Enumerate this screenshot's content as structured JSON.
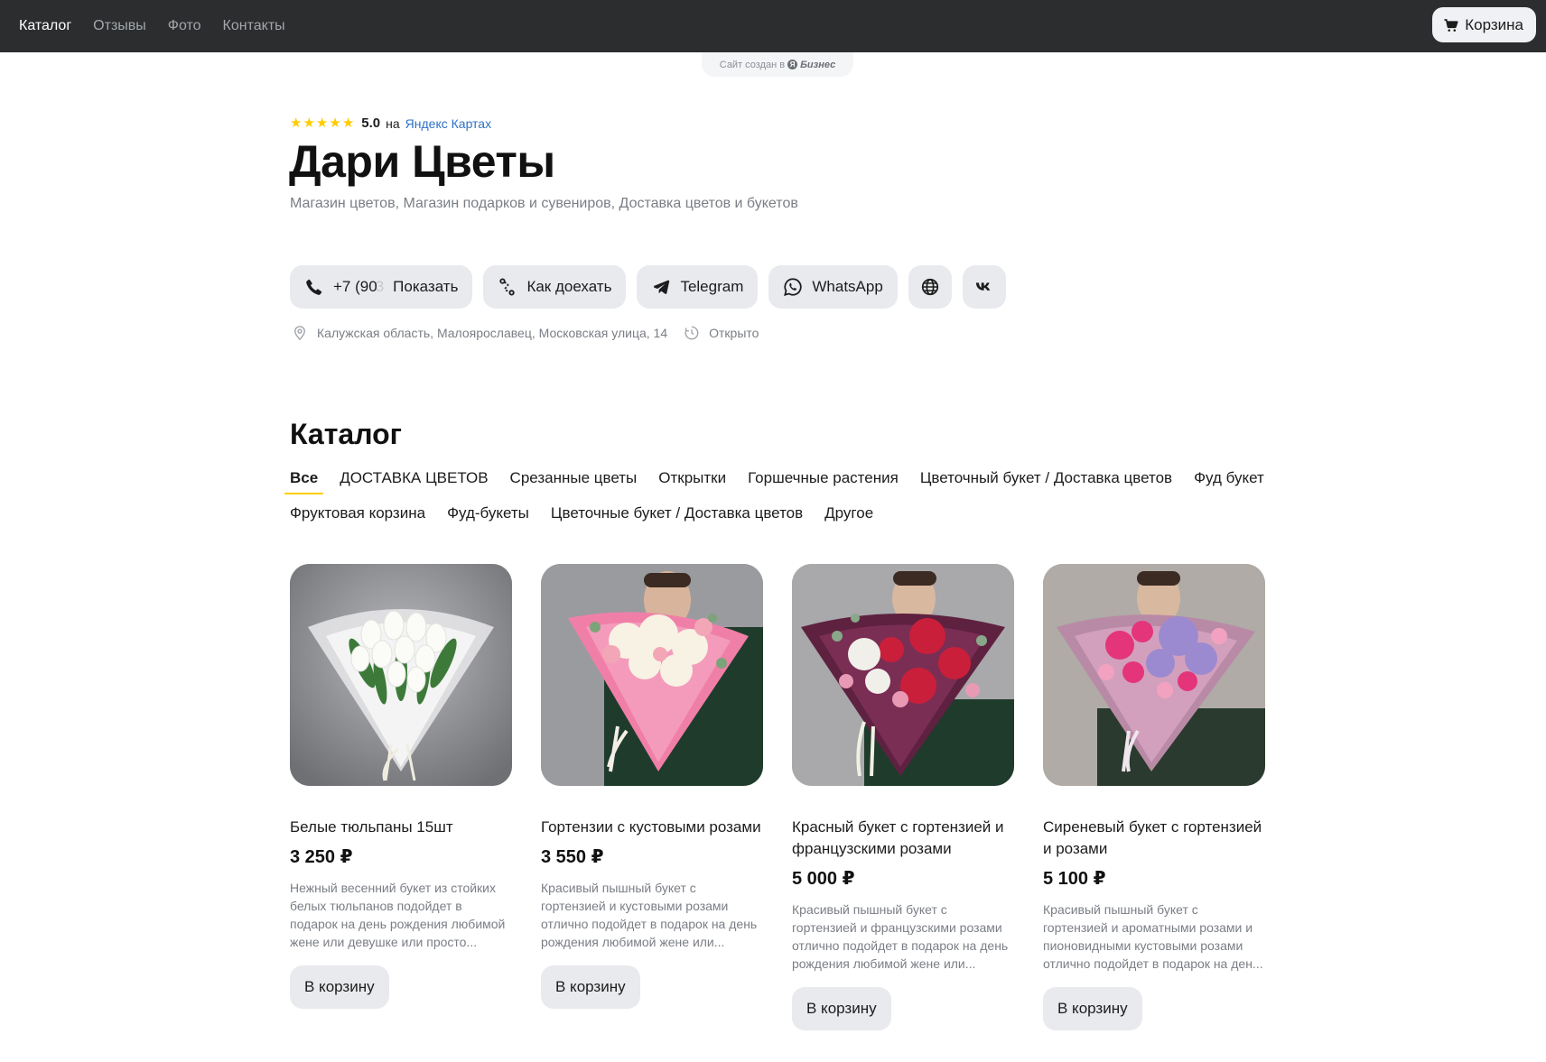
{
  "nav": {
    "items": [
      {
        "label": "Каталог",
        "active": true
      },
      {
        "label": "Отзывы",
        "active": false
      },
      {
        "label": "Фото",
        "active": false
      },
      {
        "label": "Контакты",
        "active": false
      }
    ],
    "cart_label": "Корзина"
  },
  "badge": {
    "text": "Сайт создан в",
    "brand": "Бизнес",
    "logo_letter": "Я"
  },
  "business": {
    "rating": "5.0",
    "rating_on": "на",
    "rating_source": "Яндекс Картах",
    "name": "Дари Цветы",
    "categories": "Магазин цветов, Магазин подарков и сувениров, Доставка цветов и букетов",
    "address": "Калужская область, Малоярославец, Московская улица, 14",
    "status": "Открыто"
  },
  "actions": {
    "phone_prefix": "+7 (90",
    "phone_mask": "3",
    "phone_show": "Показать",
    "route": "Как доехать",
    "telegram": "Telegram",
    "whatsapp": "WhatsApp"
  },
  "catalog": {
    "title": "Каталог",
    "tabs_row1": [
      "Все",
      "ДОСТАВКА ЦВЕТОВ",
      "Срезанные цветы",
      "Открытки",
      "Горшечные растения",
      "Цветочный букет / Доставка цветов",
      "Фуд букет"
    ],
    "tabs_row2": [
      "Фруктовая корзина",
      "Фуд-букеты",
      "Цветочные букет / Доставка цветов",
      "Другое"
    ],
    "add_label": "В корзину",
    "products": [
      {
        "name": "Белые тюльпаны 15шт",
        "price": "3 250 ₽",
        "desc": "Нежный весенний букет из стойких белых тюльпанов подойдет в подарок на день рождения любимой жене или девушке или просто..."
      },
      {
        "name": "Гортензии с кустовыми розами",
        "price": "3 550 ₽",
        "desc": "Красивый пышный букет с гортензией и кустовыми розами отлично подойдет в подарок на день рождения любимой жене или..."
      },
      {
        "name": "Красный букет с гортензией и французскими розами",
        "price": "5 000 ₽",
        "desc": "Красивый пышный букет с гортензией и французскими розами отлично подойдет в подарок на день рождения любимой жене или..."
      },
      {
        "name": "Сиреневый букет с гортензией и розами",
        "price": "5 100 ₽",
        "desc": "Красивый пышный букет с гортензией и ароматными розами и пионовидными кустовыми розами отлично подойдет в подарок на ден..."
      }
    ]
  },
  "colors": {
    "accent": "#ffcc00",
    "link": "#2f71c4",
    "topbar": "#2b2d2f",
    "button_bg": "#e9eaee"
  }
}
